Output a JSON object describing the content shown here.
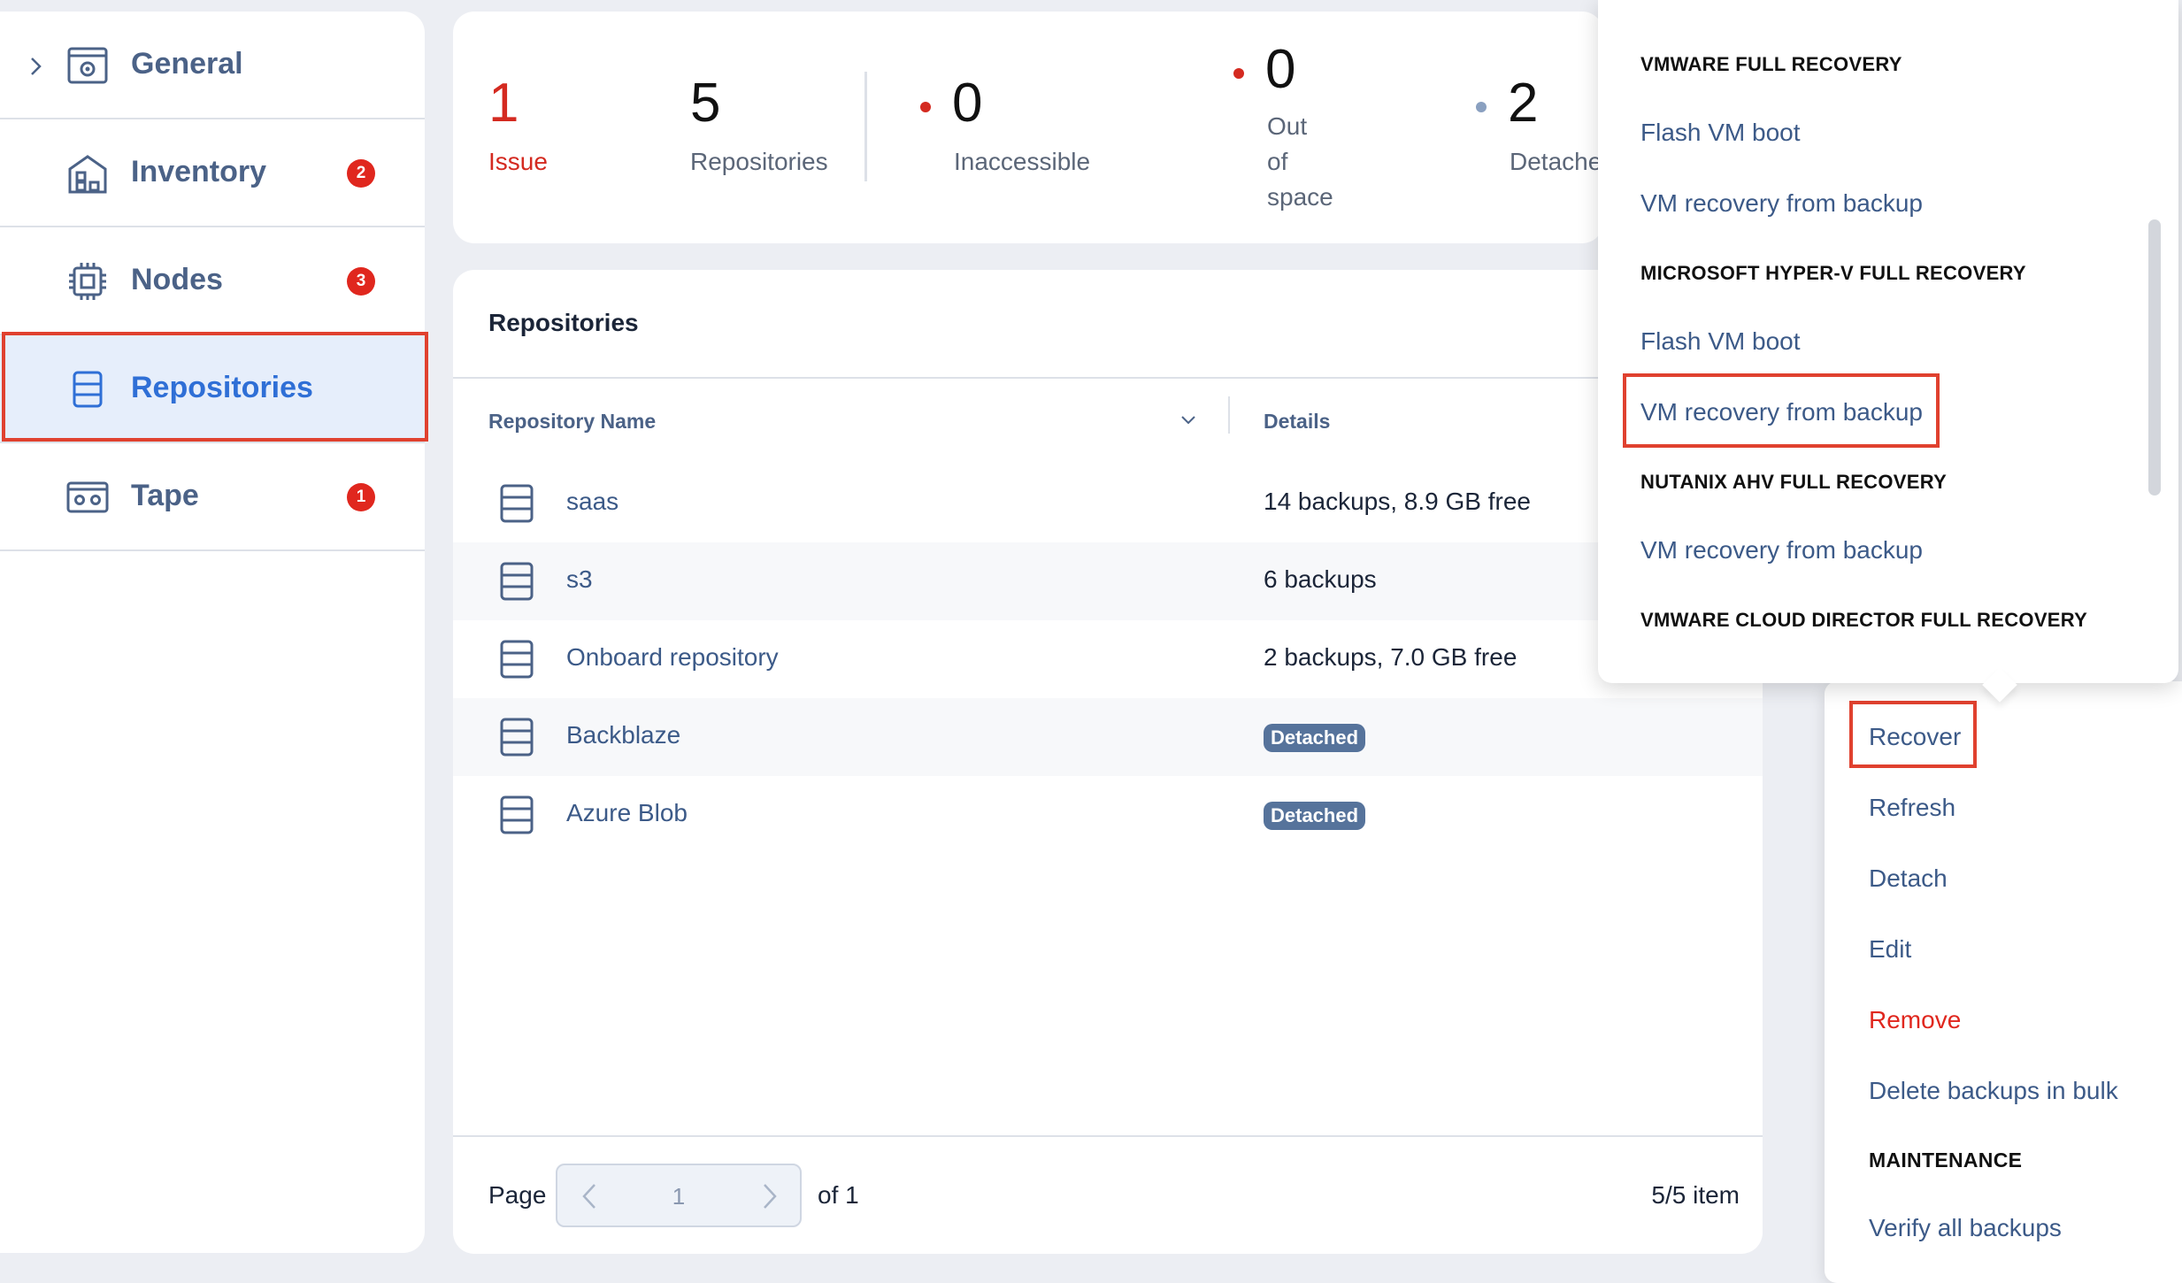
{
  "sidebar": {
    "items": [
      {
        "label": "General",
        "badge": ""
      },
      {
        "label": "Inventory",
        "badge": "2"
      },
      {
        "label": "Nodes",
        "badge": "3"
      },
      {
        "label": "Repositories",
        "badge": ""
      },
      {
        "label": "Tape",
        "badge": "1"
      }
    ]
  },
  "stats": {
    "issue": {
      "value": "1",
      "label": "Issue"
    },
    "repositories": {
      "value": "5",
      "label": "Repositories"
    },
    "inaccessible": {
      "value": "0",
      "label": "Inaccessible"
    },
    "out_of_space": {
      "value": "0",
      "label_lines": [
        "Out",
        "of",
        "space"
      ]
    },
    "detached": {
      "value": "2",
      "label": "Detache"
    }
  },
  "repos": {
    "title": "Repositories",
    "columns": {
      "name": "Repository Name",
      "details": "Details"
    },
    "rows": [
      {
        "name": "saas",
        "details": "14 backups, 8.9 GB free",
        "tag": ""
      },
      {
        "name": "s3",
        "details": "6 backups",
        "tag": ""
      },
      {
        "name": "Onboard repository",
        "details": "2 backups, 7.0 GB free",
        "tag": ""
      },
      {
        "name": "Backblaze",
        "details": "",
        "tag": "Detached"
      },
      {
        "name": "Azure Blob",
        "details": "",
        "tag": "Detached"
      }
    ],
    "footer": {
      "page_label": "Page",
      "page_value": "1",
      "of_label": "of 1",
      "items_label": "5/5 item"
    }
  },
  "action_menu": {
    "recover": "Recover",
    "refresh": "Refresh",
    "detach": "Detach",
    "edit": "Edit",
    "remove": "Remove",
    "delete_bulk": "Delete backups in bulk",
    "maintenance_header": "MAINTENANCE",
    "verify_all": "Verify all backups"
  },
  "recovery_menu": {
    "vmware_header": "VMWARE FULL RECOVERY",
    "vmware_flash": "Flash VM boot",
    "vmware_recovery": "VM recovery from backup",
    "hyperv_header": "MICROSOFT HYPER-V FULL RECOVERY",
    "hyperv_flash": "Flash VM boot",
    "hyperv_recovery": "VM recovery from backup",
    "nutanix_header": "NUTANIX AHV FULL RECOVERY",
    "nutanix_recovery": "VM recovery from backup",
    "vcd_header": "VMWARE CLOUD DIRECTOR FULL RECOVERY"
  },
  "colors": {
    "accent": "#2f6fd6",
    "link": "#3c5a88",
    "danger": "#e0271e",
    "highlight": "#e0412f",
    "tag": "#56739b"
  }
}
